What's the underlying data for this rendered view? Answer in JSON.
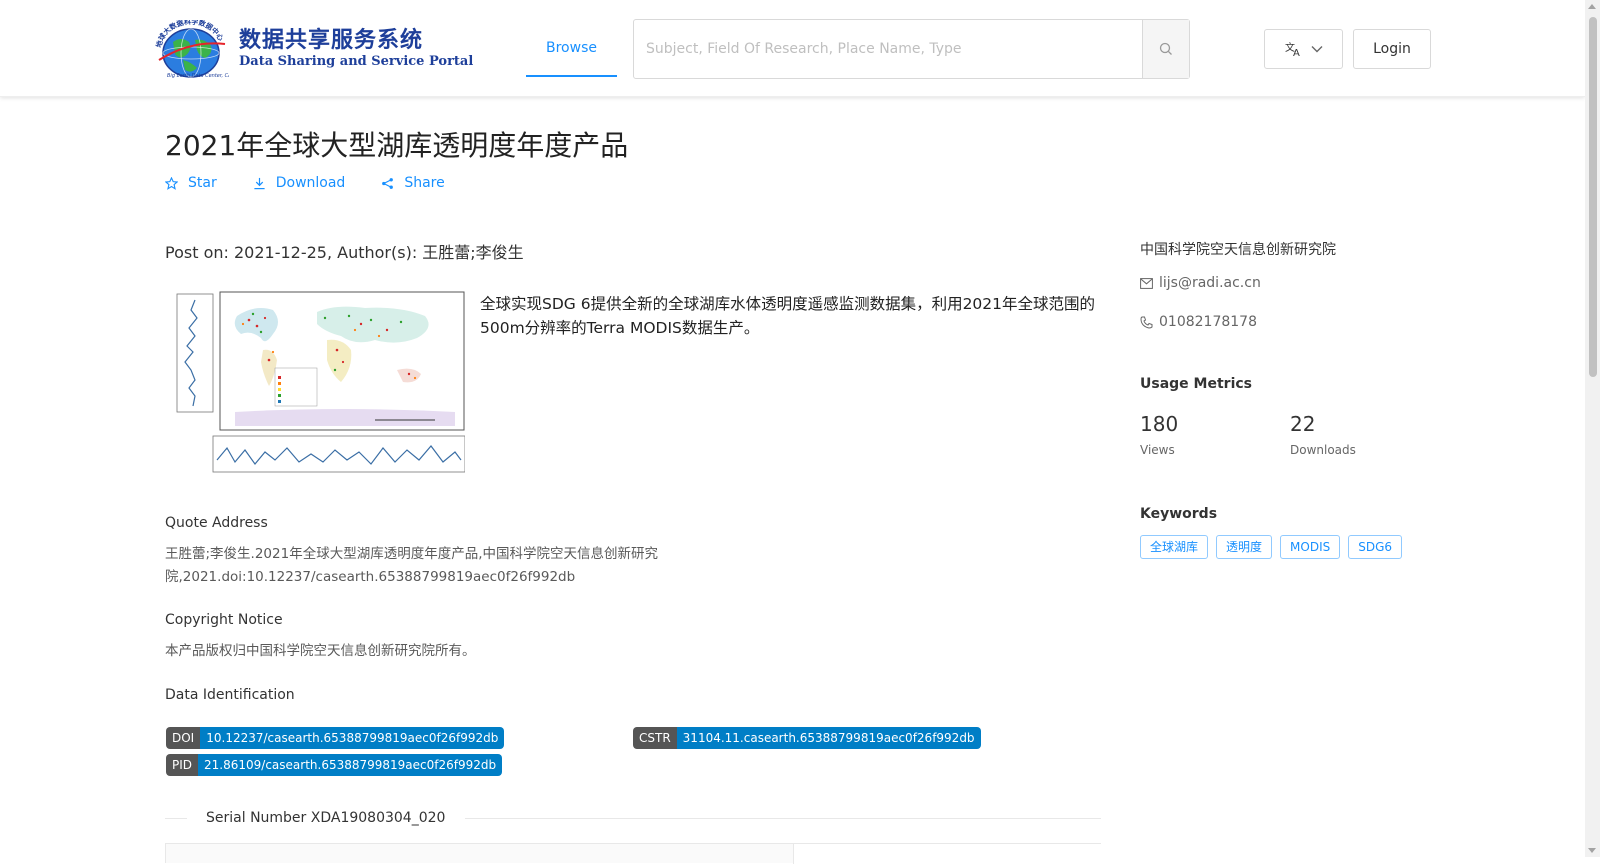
{
  "header": {
    "logo": {
      "cn_text": "数据共享服务系统",
      "en_text": "Data Sharing and Service Portal",
      "seal_text": "地球大数据科学数据中心"
    },
    "nav": {
      "browse_label": "Browse"
    },
    "search": {
      "placeholder": "Subject, Field Of Research, Place Name, Type"
    },
    "language_icon": "translate-icon",
    "login_label": "Login"
  },
  "dataset": {
    "title": "2021年全球大型湖库透明度年度产品",
    "actions": {
      "star_label": "Star",
      "download_label": "Download",
      "share_label": "Share"
    },
    "post_on": "Post on: 2021-12-25, Author(s): 王胜蕾;李俊生",
    "description": "全球实现SDG 6提供全新的全球湖库水体透明度遥感监测数据集，利用2021年全球范围的500m分辨率的Terra MODIS数据生产。",
    "quote_address_label": "Quote Address",
    "quote_address": "王胜蕾;李俊生.2021年全球大型湖库透明度年度产品,中国科学院空天信息创新研究院,2021.doi:10.12237/casearth.65388799819aec0f26f992db",
    "copyright_label": "Copyright Notice",
    "copyright": "本产品版权归中国科学院空天信息创新研究院所有。",
    "data_identification_label": "Data Identification",
    "identifiers": {
      "doi_key": "DOI",
      "doi_value": "10.12237/casearth.65388799819aec0f26f992db",
      "cstr_key": "CSTR",
      "cstr_value": "31104.11.casearth.65388799819aec0f26f992db",
      "pid_key": "PID",
      "pid_value": "21.86109/casearth.65388799819aec0f26f992db"
    },
    "serial_number": "Serial Number XDA19080304_020"
  },
  "sidebar": {
    "organization": "中国科学院空天信息创新研究院",
    "email": "lijs@radi.ac.cn",
    "phone": "01082178178",
    "usage_metrics_label": "Usage Metrics",
    "views_count": "180",
    "views_label": "Views",
    "downloads_count": "22",
    "downloads_label": "Downloads",
    "keywords_label": "Keywords",
    "keywords": [
      "全球湖库",
      "透明度",
      "MODIS",
      "SDG6"
    ]
  },
  "colors": {
    "accent": "#1890ff",
    "badge_key": "#555555",
    "badge_value": "#007ec6",
    "logo_blue": "#1e3f9a"
  }
}
